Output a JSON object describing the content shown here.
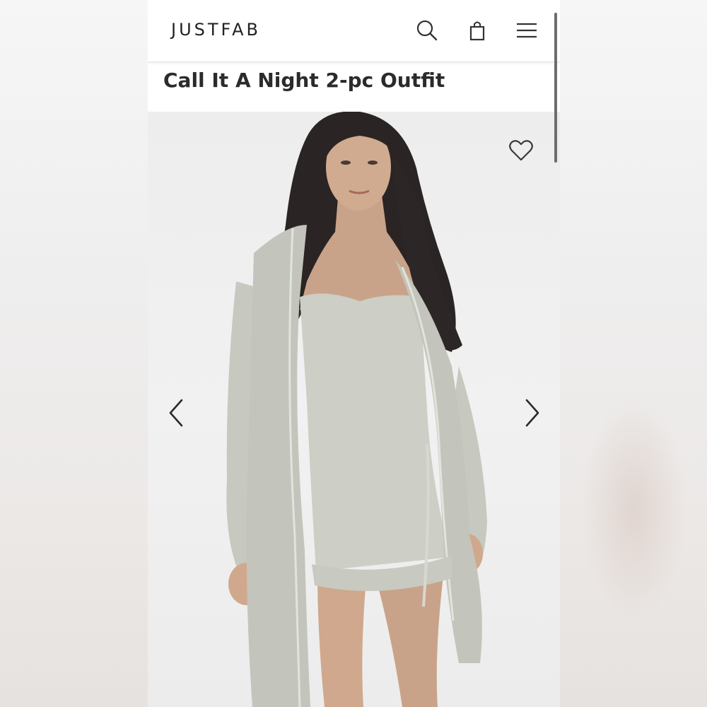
{
  "header": {
    "logo": "JUSTFAB",
    "icons": [
      "search-icon",
      "shopping-bag-icon",
      "hamburger-menu-icon"
    ]
  },
  "product": {
    "title": "Call It A Night 2-pc Outfit"
  },
  "gallery": {
    "icons": [
      "heart-icon",
      "chevron-left-icon",
      "chevron-right-icon"
    ]
  },
  "colors": {
    "accent_text": "#2b2b2b",
    "garment": "#c9cac1"
  }
}
